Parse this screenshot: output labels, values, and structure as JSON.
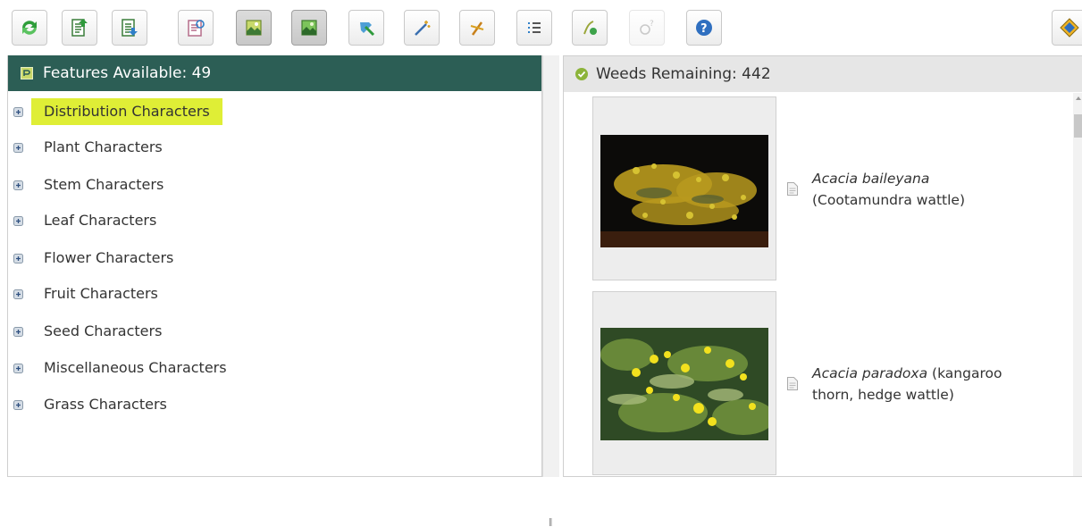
{
  "toolbar": {
    "buttons": [
      {
        "name": "restart-icon",
        "active": false
      },
      {
        "name": "best-features-icon",
        "active": false
      },
      {
        "name": "ordered-features-icon",
        "active": false
      },
      {
        "name": "separate-icon",
        "active": false
      },
      {
        "name": "view-images-icon",
        "active": true
      },
      {
        "name": "view-images-alt-icon",
        "active": true
      },
      {
        "name": "find-icon",
        "active": false
      },
      {
        "name": "magic-wand-icon",
        "active": false
      },
      {
        "name": "prune-icon",
        "active": false
      },
      {
        "name": "list-icon",
        "active": false
      },
      {
        "name": "diagnose-icon",
        "active": false
      },
      {
        "name": "differences-icon",
        "active": false,
        "disabled": true
      },
      {
        "name": "help-icon",
        "active": false
      },
      {
        "name": "options-icon",
        "active": false
      }
    ]
  },
  "features": {
    "header": "Features Available: 49",
    "items": [
      {
        "label": "Distribution Characters",
        "highlighted": true
      },
      {
        "label": "Plant Characters"
      },
      {
        "label": "Stem Characters"
      },
      {
        "label": "Leaf Characters"
      },
      {
        "label": "Flower Characters"
      },
      {
        "label": "Fruit Characters"
      },
      {
        "label": "Seed Characters"
      },
      {
        "label": "Miscellaneous Characters"
      },
      {
        "label": "Grass Characters"
      }
    ]
  },
  "weeds": {
    "header": "Weeds Remaining: 442",
    "items": [
      {
        "scientific_name": "Acacia baileyana",
        "common_name": "(Cootamundra wattle)",
        "image": "acacia-baileyana-photo"
      },
      {
        "scientific_name": "Acacia paradoxa",
        "common_name": "(kangaroo thorn, hedge wattle)",
        "image": "acacia-paradoxa-photo"
      }
    ]
  },
  "colors": {
    "features_header_bg": "#2c5e55",
    "highlight": "#dfee36",
    "weeds_header_bg": "#e6e6e6"
  }
}
